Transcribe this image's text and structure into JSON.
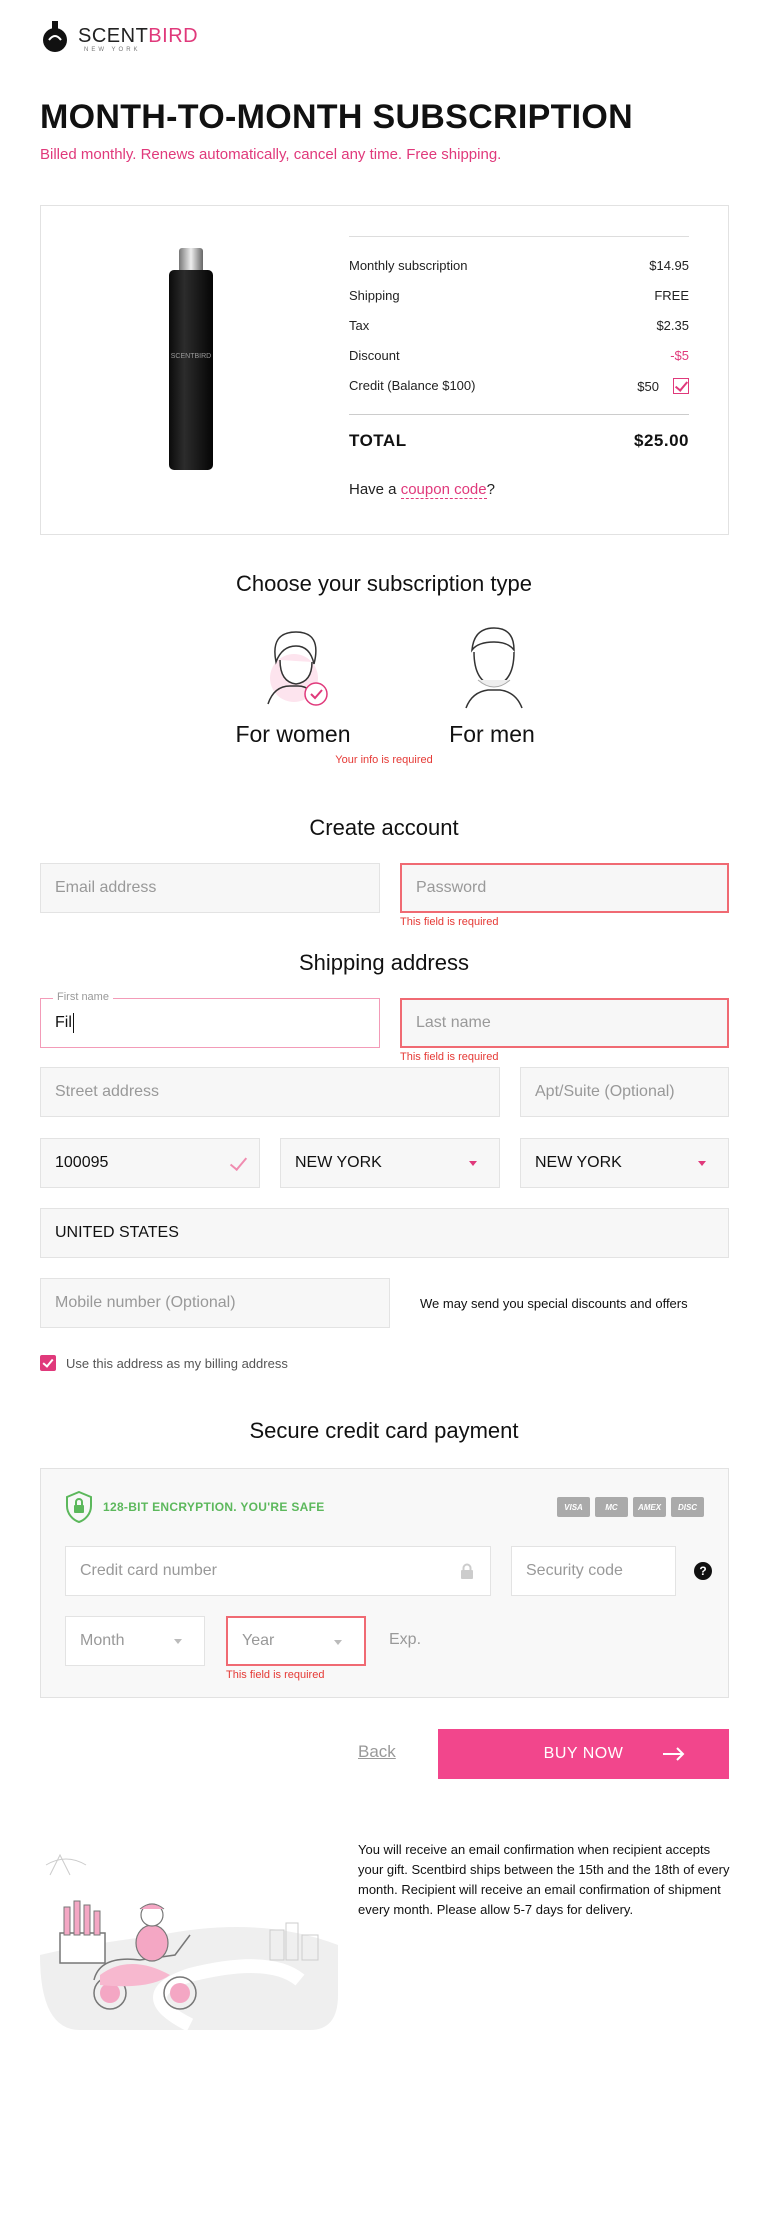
{
  "header": {
    "logo_scent": "SCENT",
    "logo_bird": "BIRD",
    "logo_sub": "NEW YORK",
    "title": "MONTH-TO-MONTH SUBSCRIPTION",
    "subtitle": "Billed monthly. Renews automatically, cancel any time. Free shipping."
  },
  "summary": {
    "rows": [
      {
        "label": "Monthly subscription",
        "value": "$14.95"
      },
      {
        "label": "Shipping",
        "value": "FREE"
      },
      {
        "label": "Tax",
        "value": "$2.35"
      },
      {
        "label": "Discount",
        "value": "-$5"
      },
      {
        "label": "Credit (Balance $100)",
        "value": "$50"
      }
    ],
    "total_label": "TOTAL",
    "total_value": "$25.00",
    "coupon_prefix": "Have a ",
    "coupon_link": "coupon code",
    "coupon_suffix": "?"
  },
  "subscription": {
    "title": "Choose your subscription type",
    "women": "For women",
    "men": "For men",
    "error": "Your info is required"
  },
  "account": {
    "title": "Create account",
    "email_placeholder": "Email address",
    "password_placeholder": "Password",
    "password_error": "This field is required"
  },
  "shipping": {
    "title": "Shipping address",
    "first_name_label": "First name",
    "first_name_value": "Fil",
    "last_name_placeholder": "Last name",
    "last_name_error": "This field is required",
    "street_placeholder": "Street address",
    "apt_placeholder": "Apt/Suite (Optional)",
    "zip_value": "100095",
    "city_value": "NEW YORK",
    "state_value": "NEW YORK",
    "country_value": "UNITED STATES",
    "mobile_placeholder": "Mobile number (Optional)",
    "mobile_note": "We may send you special discounts and offers",
    "billing_label": "Use this address as my billing address"
  },
  "payment": {
    "title": "Secure credit card payment",
    "secure_text": "128-BIT ENCRYPTION. YOU'RE SAFE",
    "cards": [
      "VISA",
      "MC",
      "AMEX",
      "DISC"
    ],
    "card_number_placeholder": "Credit card number",
    "security_placeholder": "Security code",
    "help": "?",
    "month_placeholder": "Month",
    "year_placeholder": "Year",
    "exp_label": "Exp.",
    "year_error": "This field is required"
  },
  "actions": {
    "back": "Back",
    "buy": "BUY NOW"
  },
  "footer": {
    "text": "You will receive an email confirmation when recipient accepts your gift. Scentbird ships between the 15th and the 18th of every month. Recipient will receive an email confirmation of shipment every month. Please allow 5-7 days for delivery."
  },
  "colors": {
    "brand_pink": "#e0397b",
    "button_pink": "#f2468c",
    "error_red": "#e53935",
    "secure_green": "#5cb85c"
  }
}
